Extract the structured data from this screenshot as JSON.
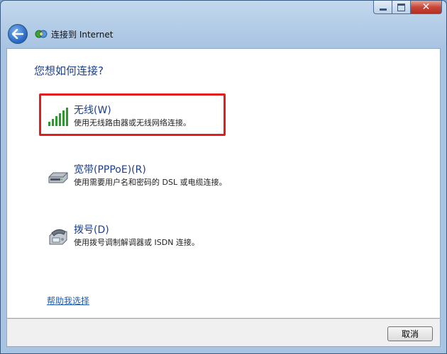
{
  "window": {
    "title": "连接到 Internet",
    "caption": {
      "minimize": "minimize",
      "maximize": "maximize",
      "close": "✕"
    }
  },
  "main": {
    "heading": "您想如何连接?",
    "options": [
      {
        "title": "无线(W)",
        "description": "使用无线路由器或无线网络连接。",
        "icon": "wireless-signal-icon",
        "highlighted": true
      },
      {
        "title": "宽带(PPPoE)(R)",
        "description": "使用需要用户名和密码的 DSL 或电缆连接。",
        "icon": "broadband-modem-icon",
        "highlighted": false
      },
      {
        "title": "拨号(D)",
        "description": "使用拨号调制解调器或 ISDN 连接。",
        "icon": "dialup-phone-icon",
        "highlighted": false
      }
    ],
    "help_link": "帮助我选择"
  },
  "footer": {
    "cancel_label": "取消"
  },
  "colors": {
    "heading": "#1b3f8b",
    "link": "#1e5bb8",
    "highlight_border": "#e01e1e",
    "signal_green": "#2e9a2e"
  }
}
